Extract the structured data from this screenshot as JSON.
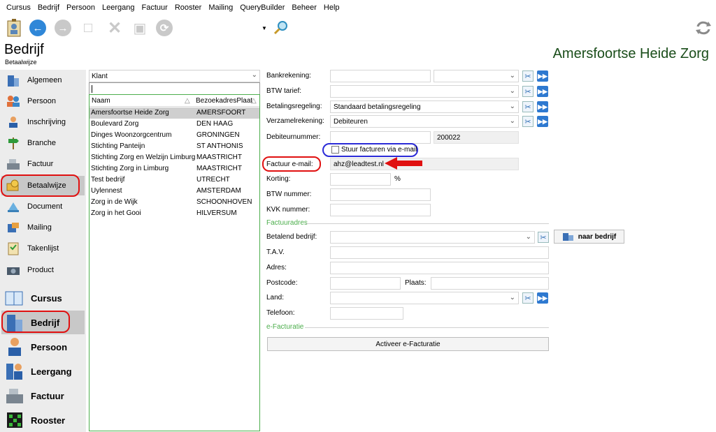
{
  "menu": [
    "Cursus",
    "Bedrijf",
    "Persoon",
    "Leergang",
    "Factuur",
    "Rooster",
    "Mailing",
    "QueryBuilder",
    "Beheer",
    "Help"
  ],
  "module": {
    "title": "Bedrijf",
    "subtitle": "Betaalwijze"
  },
  "entity_title": "Amersfoortse Heide Zorg",
  "sidebar": {
    "items": [
      {
        "label": "Algemeen",
        "icon": "building-icon"
      },
      {
        "label": "Persoon",
        "icon": "people-icon"
      },
      {
        "label": "Inschrijving",
        "icon": "person-icon"
      },
      {
        "label": "Branche",
        "icon": "signpost-icon"
      },
      {
        "label": "Factuur",
        "icon": "cash-register-icon"
      },
      {
        "label": "Betaalwijze",
        "icon": "money-icon"
      },
      {
        "label": "Document",
        "icon": "document-icon"
      },
      {
        "label": "Mailing",
        "icon": "mailing-icon"
      },
      {
        "label": "Takenlijst",
        "icon": "checklist-icon"
      },
      {
        "label": "Product",
        "icon": "camera-icon"
      }
    ],
    "modules": [
      {
        "label": "Cursus",
        "icon": "book-icon"
      },
      {
        "label": "Bedrijf",
        "icon": "building-icon"
      },
      {
        "label": "Persoon",
        "icon": "person-icon"
      },
      {
        "label": "Leergang",
        "icon": "course-icon"
      },
      {
        "label": "Factuur",
        "icon": "cash-register-icon"
      },
      {
        "label": "Rooster",
        "icon": "schedule-icon"
      }
    ]
  },
  "list": {
    "filter": "Klant",
    "search": "",
    "columns": [
      "Naam",
      "BezoekadresPlaat"
    ],
    "rows": [
      {
        "naam": "Amersfoortse Heide Zorg",
        "plaats": "AMERSFOORT"
      },
      {
        "naam": "Boulevard Zorg",
        "plaats": "DEN HAAG"
      },
      {
        "naam": "Dinges Woonzorgcentrum",
        "plaats": "GRONINGEN"
      },
      {
        "naam": "Stichting Panteijn",
        "plaats": "ST ANTHONIS"
      },
      {
        "naam": "Stichting Zorg en Welzijn Limburg",
        "plaats": "MAASTRICHT"
      },
      {
        "naam": "Stichting Zorg in Limburg",
        "plaats": "MAASTRICHT"
      },
      {
        "naam": "Test bedrijf",
        "plaats": "UTRECHT"
      },
      {
        "naam": "Uylennest",
        "plaats": "AMSTERDAM"
      },
      {
        "naam": "Zorg in de Wijk",
        "plaats": "SCHOONHOVEN"
      },
      {
        "naam": "Zorg in het Gooi",
        "plaats": "HILVERSUM"
      }
    ]
  },
  "form": {
    "bankrekening": {
      "label": "Bankrekening:",
      "value": "",
      "second": ""
    },
    "btw_tarief": {
      "label": "BTW tarief:",
      "value": ""
    },
    "betalingsregeling": {
      "label": "Betalingsregeling:",
      "value": "Standaard betalingsregeling"
    },
    "verzamelrekening": {
      "label": "Verzamelrekening:",
      "value": "Debiteuren"
    },
    "debiteurnummer": {
      "label": "Debiteurnummer:",
      "value": "",
      "readonly": "200022"
    },
    "stuur_facturen": {
      "label": "Stuur facturen via e-mail",
      "checked": false
    },
    "factuur_email": {
      "label": "Factuur e-mail:",
      "value": "ahz@leadtest.nl"
    },
    "korting": {
      "label": "Korting:",
      "value": "",
      "unit": "%"
    },
    "btw_nummer": {
      "label": "BTW nummer:",
      "value": ""
    },
    "kvk_nummer": {
      "label": "KVK nummer:",
      "value": ""
    },
    "factuuradres_title": "Factuuradres",
    "betalend_bedrijf": {
      "label": "Betalend bedrijf:",
      "value": ""
    },
    "naar_bedrijf": "naar bedrijf",
    "tav": {
      "label": "T.A.V.",
      "value": ""
    },
    "adres": {
      "label": "Adres:",
      "value": ""
    },
    "postcode": {
      "label": "Postcode:",
      "value": ""
    },
    "plaats": {
      "label": "Plaats:",
      "value": ""
    },
    "land": {
      "label": "Land:",
      "value": ""
    },
    "telefoon": {
      "label": "Telefoon:",
      "value": ""
    },
    "efacturatie_title": "e-Facturatie",
    "activeer": "Activeer e-Facturatie"
  }
}
